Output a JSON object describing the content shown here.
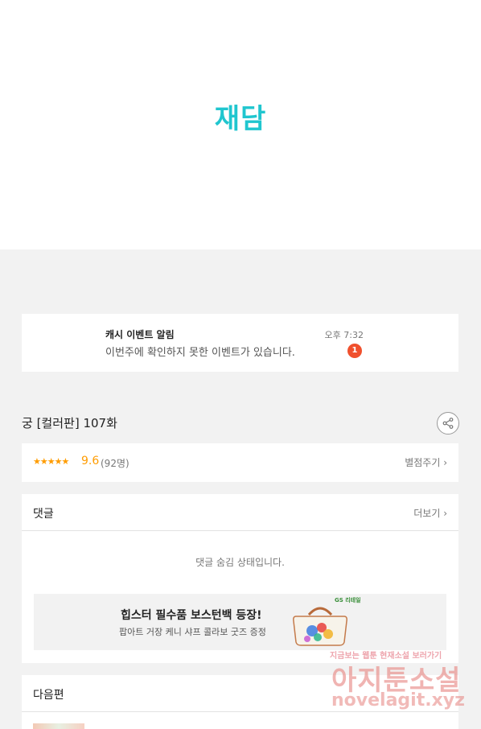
{
  "brand": {
    "logo_text": "재담",
    "logo_color": "#20c6cf"
  },
  "notification": {
    "title": "캐시 이벤트 알림",
    "body": "이번주에 확인하지 못한 이벤트가 있습니다.",
    "time": "오후 7:32",
    "badge_count": "1",
    "badge_color": "#f0502d"
  },
  "episode": {
    "title": "궁 [컬러판] 107화",
    "share_icon": "share-icon"
  },
  "rating": {
    "stars": "★★★★★",
    "score": "9.6",
    "count": "(92명)",
    "rate_label": "별점주기 ›",
    "accent_color": "#ff9c00"
  },
  "comments": {
    "title": "댓글",
    "more_label": "더보기 ›",
    "hidden_message": "댓글 숨김 상태입니다."
  },
  "ad": {
    "title": "힙스터 필수품 보스턴백 등장!",
    "subtitle": "팝아트 거장 케니 샤프 콜라보 굿즈 증정",
    "brand": "GS 리테일"
  },
  "next": {
    "title": "다음편"
  },
  "watermark": {
    "tagline": "지금보는 웹툰 현재소설 보러가기",
    "name": "아지툰소설",
    "url": "novelagit.xyz"
  }
}
